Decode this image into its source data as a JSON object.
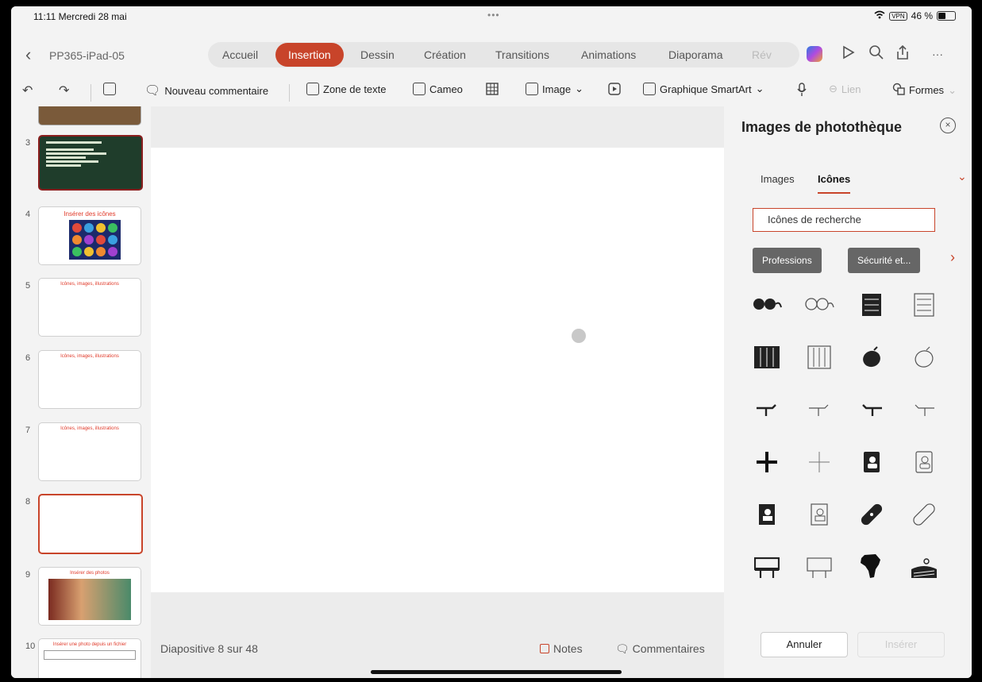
{
  "status": {
    "time": "11:11",
    "date": "Mercredi 28 mai",
    "dots": "•••",
    "vpn": "VPN",
    "battery": "46 %"
  },
  "header": {
    "doc_name": "PP365-iPad-05",
    "tabs": [
      {
        "label": "Accueil"
      },
      {
        "label": "Insertion"
      },
      {
        "label": "Dessin"
      },
      {
        "label": "Création"
      },
      {
        "label": "Transitions"
      },
      {
        "label": "Animations"
      },
      {
        "label": "Diaporama"
      },
      {
        "label": "Rév"
      }
    ],
    "more_icon": "···"
  },
  "toolbar": {
    "new_comment": "Nouveau commentaire",
    "text_box": "Zone de texte",
    "cameo": "Cameo",
    "image": "Image",
    "smartart": "Graphique SmartArt",
    "link": "Lien",
    "shapes": "Formes"
  },
  "slides": [
    {
      "num": "3"
    },
    {
      "num": "4",
      "title": "Insérer des icônes"
    },
    {
      "num": "5",
      "title": "Icônes, images, illustrations"
    },
    {
      "num": "6",
      "title": "Icônes, images, illustrations"
    },
    {
      "num": "7",
      "title": "Icônes, images, illustrations"
    },
    {
      "num": "8"
    },
    {
      "num": "9",
      "title": "Insérer des photos"
    },
    {
      "num": "10",
      "title": "Insérer une photo depuis un fichier"
    }
  ],
  "footer": {
    "slide_counter": "Diapositive 8 sur 48",
    "notes": "Notes",
    "comments": "Commentaires"
  },
  "panel": {
    "title": "Images de photothèque",
    "tabs": {
      "images": "Images",
      "icons": "Icônes"
    },
    "search_value": "Icônes de recherche",
    "categories": [
      "Professions",
      "Sécurité et..."
    ],
    "cancel": "Annuler",
    "insert": "Insérer"
  },
  "colors": {
    "accent": "#c8442a",
    "panel_bg": "#f3f3f3"
  }
}
